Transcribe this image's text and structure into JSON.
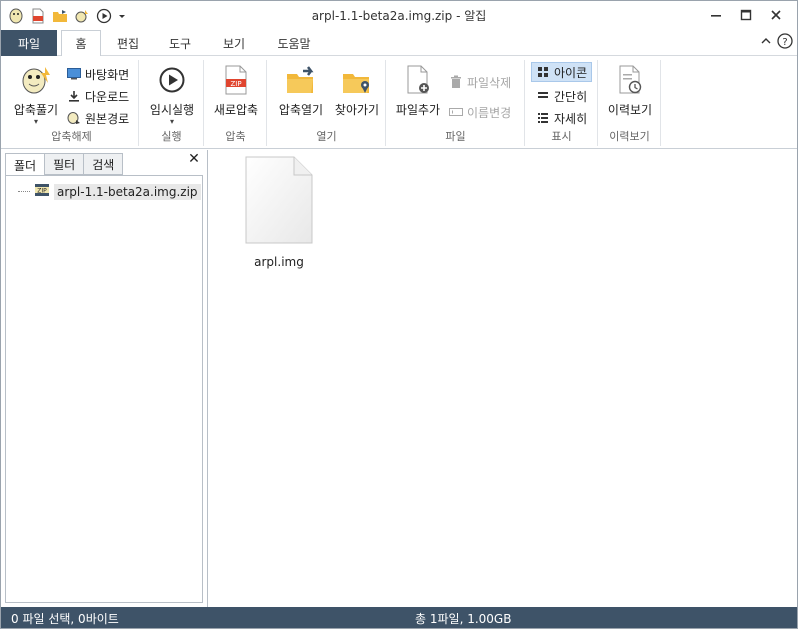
{
  "window": {
    "title": "arpl-1.1-beta2a.img.zip - 알집"
  },
  "qat": {
    "icons": [
      "app-logo-icon",
      "zip-new-icon",
      "folder-open-icon",
      "extract-icon",
      "play-icon",
      "qat-dropdown-icon"
    ]
  },
  "tabs": {
    "file": "파일",
    "home": "홈",
    "edit": "편집",
    "tools": "도구",
    "view": "보기",
    "help": "도움말"
  },
  "ribbon": {
    "extract": {
      "label": "압축해제",
      "big": "압축풀기",
      "desktop": "바탕화면",
      "download": "다운로드",
      "original": "원본경로"
    },
    "run": {
      "label": "실행",
      "temp_run": "임시실행"
    },
    "compress": {
      "label": "압축",
      "new": "새로압축"
    },
    "open": {
      "label": "열기",
      "open_zip": "압축열기",
      "find": "찾아가기"
    },
    "file": {
      "label": "파일",
      "add": "파일추가",
      "delete": "파일삭제",
      "rename": "이름변경"
    },
    "display": {
      "label": "표시",
      "icon": "아이콘",
      "simple": "간단히",
      "detail": "자세히"
    },
    "history": {
      "label": "이력보기",
      "view": "이력보기"
    }
  },
  "left_panel": {
    "tabs": [
      "폴더",
      "필터",
      "검색"
    ],
    "tree_item": "arpl-1.1-beta2a.img.zip"
  },
  "files": [
    {
      "name": "arpl.img"
    }
  ],
  "status": {
    "left": "0 파일 선택,  0바이트",
    "center": "총 1파일,  1.00GB"
  },
  "colors": {
    "accent": "#3e5368",
    "selected": "#cfe2f6",
    "zip_red": "#e0452f",
    "folder_yellow": "#f2b83a"
  }
}
